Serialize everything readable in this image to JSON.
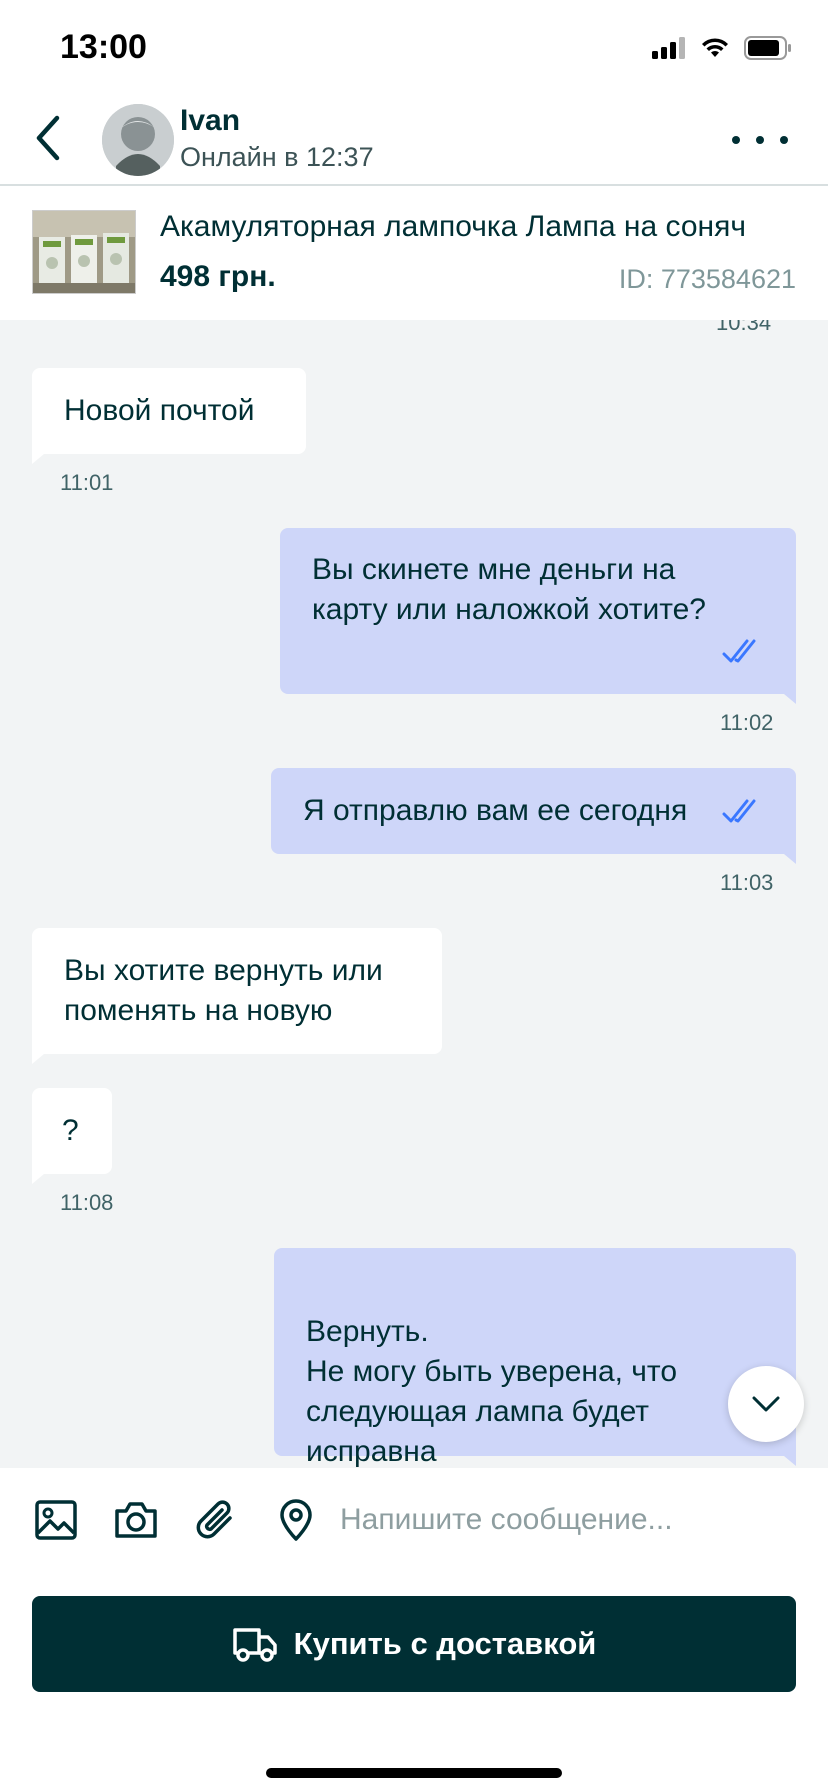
{
  "status_bar": {
    "time": "13:00"
  },
  "header": {
    "contact_name": "Ivan",
    "contact_status": "Онлайн в 12:37"
  },
  "listing": {
    "title": "Акамуляторная лампочка Лампа на соняч",
    "price": "498 грн.",
    "id": "ID: 773584621"
  },
  "chat": {
    "partial_time": "10:34",
    "messages": [
      {
        "direction": "in",
        "text": "Новой почтой",
        "time": "11:01"
      },
      {
        "direction": "out",
        "text": "Вы скинете мне деньги на карту или наложкой хотите?",
        "time": "11:02",
        "read": true
      },
      {
        "direction": "out",
        "text": "Я отправлю вам ее сегодня",
        "time": "11:03",
        "read": true
      },
      {
        "direction": "in",
        "text": "Вы хотите вернуть или поменять на новую"
      },
      {
        "direction": "in",
        "text": "?",
        "time": "11:08"
      },
      {
        "direction": "out",
        "text": "Вернуть.\nНе могу быть уверена, что следующая лампа будет исправна",
        "read": true
      }
    ]
  },
  "composer": {
    "placeholder": "Напишите сообщение...",
    "icons": [
      "image-icon",
      "camera-icon",
      "paperclip-icon",
      "location-pin-icon"
    ]
  },
  "cta": {
    "label": "Купить с доставкой",
    "icon": "truck-icon"
  },
  "colors": {
    "primary": "#002f34",
    "outgoing_bubble": "#ced6f9",
    "incoming_bubble": "#ffffff",
    "read_check": "#3a77ff",
    "chat_background": "#f2f4f5"
  }
}
